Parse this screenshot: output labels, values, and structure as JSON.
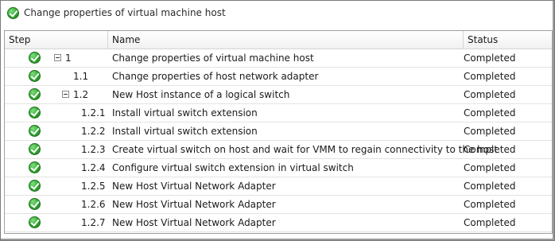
{
  "dialog": {
    "title": "Change properties of virtual machine host",
    "title_icon": "check-circle-icon"
  },
  "columns": {
    "step": "Step",
    "name": "Name",
    "status": "Status"
  },
  "rows": [
    {
      "step": "1",
      "name": "Change properties of virtual machine host",
      "status": "Completed",
      "expandable": true,
      "level": 0
    },
    {
      "step": "1.1",
      "name": "Change properties of host network adapter",
      "status": "Completed",
      "expandable": false,
      "level": 1
    },
    {
      "step": "1.2",
      "name": "New Host instance of a logical switch",
      "status": "Completed",
      "expandable": true,
      "level": 1
    },
    {
      "step": "1.2.1",
      "name": "Install virtual switch extension",
      "status": "Completed",
      "expandable": false,
      "level": 2
    },
    {
      "step": "1.2.2",
      "name": "Install virtual switch extension",
      "status": "Completed",
      "expandable": false,
      "level": 2
    },
    {
      "step": "1.2.3",
      "name": "Create virtual switch on host and wait for VMM to regain connectivity to the host",
      "status": "Completed",
      "expandable": false,
      "level": 2
    },
    {
      "step": "1.2.4",
      "name": "Configure virtual switch extension in virtual switch",
      "status": "Completed",
      "expandable": false,
      "level": 2
    },
    {
      "step": "1.2.5",
      "name": "New Host Virtual Network Adapter",
      "status": "Completed",
      "expandable": false,
      "level": 2
    },
    {
      "step": "1.2.6",
      "name": "New Host Virtual Network Adapter",
      "status": "Completed",
      "expandable": false,
      "level": 2
    },
    {
      "step": "1.2.7",
      "name": "New Host Virtual Network Adapter",
      "status": "Completed",
      "expandable": false,
      "level": 2
    }
  ]
}
